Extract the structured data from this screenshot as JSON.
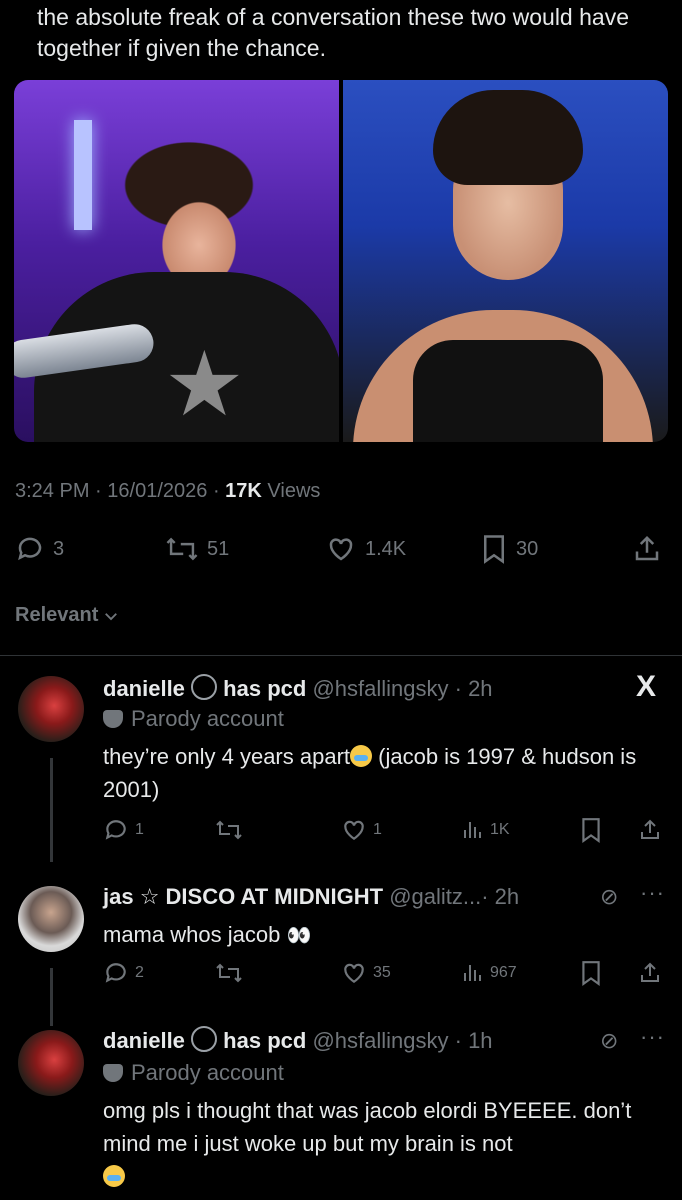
{
  "tweet": {
    "text": "the absolute freak of a conversation these two would have together if given the chance.",
    "time": "3:24 PM",
    "date": "16/01/2026",
    "views_count": "17K",
    "views_label": "Views"
  },
  "actions": {
    "replies": "3",
    "reposts": "51",
    "likes": "1.4K",
    "bookmarks": "30"
  },
  "sort": {
    "label": "Relevant"
  },
  "replies": [
    {
      "name": "danielle",
      "name_suffix": "has pcd",
      "handle": "@hsfallingsky",
      "time": "· 2h",
      "parody": "Parody account",
      "text_a": "they’re only 4 years apart",
      "text_b": " (jacob is 1997 & hudson is 2001)",
      "reply_count": "1",
      "repost_count": "",
      "like_count": "1",
      "view_count": "1K"
    },
    {
      "name": "jas ☆ DISCO AT MIDNIGHT",
      "handle": "@galitz...",
      "time": "· 2h",
      "text_a": "mama whos jacob",
      "reply_count": "2",
      "repost_count": "",
      "like_count": "35",
      "view_count": "967"
    },
    {
      "name": "danielle",
      "name_suffix": "has pcd",
      "handle": "@hsfallingsky",
      "time": "· 1h",
      "parody": "Parody account",
      "text_a": "omg pls i thought that was jacob elordi BYEEEE. don’t mind me i just woke up but my brain is not"
    }
  ],
  "icons": {
    "x_logo": "X"
  }
}
